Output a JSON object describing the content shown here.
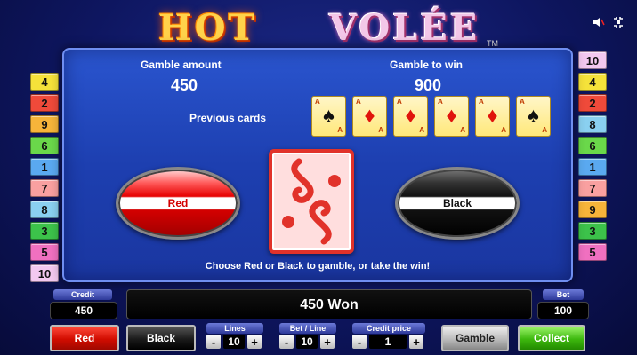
{
  "logo": {
    "hot": "HOT",
    "volee": "VOLÉE",
    "tm": "TM"
  },
  "top_icons": [
    "speaker-icon",
    "settings-icon"
  ],
  "left_lines": [
    {
      "n": "4",
      "color": "#f5e23a"
    },
    {
      "n": "2",
      "color": "#ef4a3a"
    },
    {
      "n": "9",
      "color": "#f6b43a"
    },
    {
      "n": "6",
      "color": "#6ad84a"
    },
    {
      "n": "1",
      "color": "#5aa9f0"
    },
    {
      "n": "7",
      "color": "#f9a0a0"
    },
    {
      "n": "8",
      "color": "#8ad0f0"
    },
    {
      "n": "3",
      "color": "#3cc24a"
    },
    {
      "n": "5",
      "color": "#f070c0"
    },
    {
      "n": "10",
      "color": "#f3c8f0"
    }
  ],
  "right_lines": [
    {
      "n": "10",
      "color": "#f3c8f0"
    },
    {
      "n": "4",
      "color": "#f5e23a"
    },
    {
      "n": "2",
      "color": "#ef4a3a"
    },
    {
      "n": "8",
      "color": "#8ad0f0"
    },
    {
      "n": "6",
      "color": "#6ad84a"
    },
    {
      "n": "1",
      "color": "#5aa9f0"
    },
    {
      "n": "7",
      "color": "#f9a0a0"
    },
    {
      "n": "9",
      "color": "#f6b43a"
    },
    {
      "n": "3",
      "color": "#3cc24a"
    },
    {
      "n": "5",
      "color": "#f070c0"
    }
  ],
  "gamble": {
    "amount_label": "Gamble amount",
    "amount_value": "450",
    "to_win_label": "Gamble to win",
    "to_win_value": "900",
    "previous_label": "Previous cards",
    "previous_cards": [
      {
        "rank": "A",
        "suit": "♠",
        "color": "black"
      },
      {
        "rank": "A",
        "suit": "♦",
        "color": "red"
      },
      {
        "rank": "A",
        "suit": "♦",
        "color": "red"
      },
      {
        "rank": "A",
        "suit": "♦",
        "color": "red"
      },
      {
        "rank": "A",
        "suit": "♦",
        "color": "red"
      },
      {
        "rank": "A",
        "suit": "♠",
        "color": "black"
      }
    ],
    "red_label": "Red",
    "black_label": "Black",
    "hint": "Choose Red or Black to gamble, or take the win!"
  },
  "bottom": {
    "credit_label": "Credit",
    "credit_value": "450",
    "message": "450 Won",
    "bet_label": "Bet",
    "bet_value": "100",
    "red_btn": "Red",
    "black_btn": "Black",
    "lines_label": "Lines",
    "lines_value": "10",
    "bet_line_label": "Bet / Line",
    "bet_line_value": "10",
    "credit_price_label": "Credit price",
    "credit_price_value": "1",
    "gamble_btn": "Gamble",
    "collect_btn": "Collect",
    "minus": "-",
    "plus": "+"
  }
}
